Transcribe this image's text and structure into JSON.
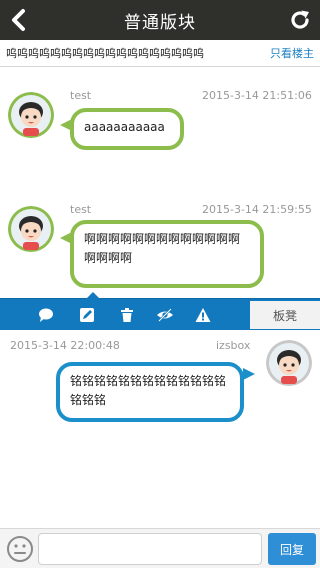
{
  "header": {
    "title": "普通版块",
    "back_icon": "chevron-left-icon",
    "refresh_icon": "refresh-icon"
  },
  "subheader": {
    "thread_title": "呜呜呜呜呜呜呜呜呜呜呜呜呜呜呜呜呜呜",
    "only_op": "只看楼主"
  },
  "posts": [
    {
      "author": "test",
      "time": "2015-3-14 21:51:06",
      "content": "aaaaaaaaaaa",
      "color": "#8cbd4c"
    },
    {
      "author": "test",
      "time": "2015-3-14 21:59:55",
      "content": "啊啊啊啊啊啊啊啊啊啊啊啊啊啊啊啊啊",
      "color": "#8cbd4c"
    },
    {
      "author": "izsbox",
      "time": "2015-3-14 22:00:48",
      "content": "铭铭铭铭铭铭铭铭铭铭铭铭铭铭铭铭",
      "color": "#1a8fc9"
    }
  ],
  "actionbar": {
    "icons": [
      "comment-icon",
      "edit-icon",
      "trash-icon",
      "eye-off-icon",
      "warning-icon"
    ],
    "board_label": "板凳",
    "color": "#1279bf"
  },
  "bottombar": {
    "reply_placeholder": "",
    "reply_label": "回复",
    "emoji_icon": "smiley-icon"
  }
}
